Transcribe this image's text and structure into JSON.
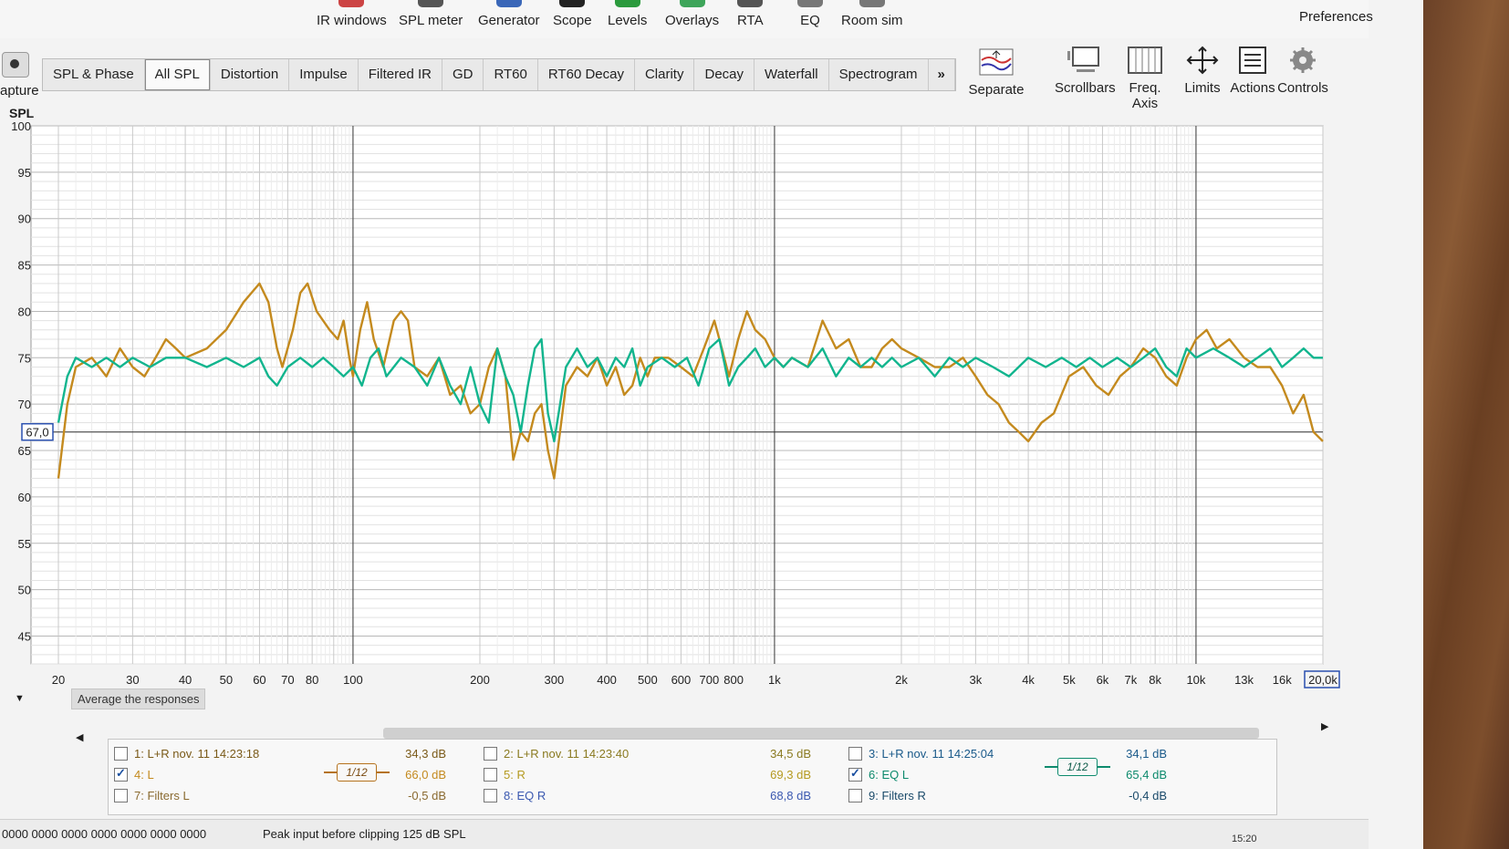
{
  "toolbar": {
    "buttons": [
      {
        "label": "IR windows",
        "x": 355,
        "color": "#c44"
      },
      {
        "label": "SPL meter",
        "x": 445,
        "color": "#555"
      },
      {
        "label": "Generator",
        "x": 532,
        "color": "#3a67b8"
      },
      {
        "label": "Scope",
        "x": 614,
        "color": "#222"
      },
      {
        "label": "Levels",
        "x": 674,
        "color": "#2b9a3d"
      },
      {
        "label": "Overlays",
        "x": 737,
        "color": "#3ea55a"
      },
      {
        "label": "RTA",
        "x": 816,
        "color": "#555"
      },
      {
        "label": "EQ",
        "x": 882,
        "color": "#777"
      },
      {
        "label": "Room sim",
        "x": 930,
        "color": "#777"
      }
    ],
    "preferences": "Preferences"
  },
  "capture_label": "apture",
  "tabs": [
    "SPL & Phase",
    "All SPL",
    "Distortion",
    "Impulse",
    "Filtered IR",
    "GD",
    "RT60",
    "RT60 Decay",
    "Clarity",
    "Decay",
    "Waterfall",
    "Spectrogram",
    "»"
  ],
  "active_tab": "All SPL",
  "right_tools": [
    "Separate",
    "Scrollbars",
    "Freq. Axis",
    "Limits",
    "Actions",
    "Controls"
  ],
  "graph": {
    "y_label": "SPL",
    "y_ticks": [
      "100",
      "95",
      "90",
      "85",
      "80",
      "75",
      "70",
      "65",
      "60",
      "55",
      "50",
      "45"
    ],
    "x_ticks": [
      "20",
      "30",
      "40",
      "50",
      "60",
      "70",
      "80",
      "100",
      "200",
      "300",
      "400",
      "500",
      "600",
      "700",
      "800",
      "1k",
      "2k",
      "3k",
      "4k",
      "5k",
      "6k",
      "7k",
      "8k",
      "10k",
      "13k",
      "16k",
      "20,0k"
    ],
    "cursor_value": "67,0",
    "average_button": "Average the responses"
  },
  "chart_data": {
    "type": "line",
    "xlabel": "",
    "ylabel": "SPL",
    "xscale": "log",
    "xlim": [
      20,
      20000
    ],
    "ylim": [
      42,
      100
    ],
    "reference_line_y": 67,
    "series": [
      {
        "name": "4: L",
        "color": "#c48a1e",
        "points": [
          [
            19,
            57
          ],
          [
            20,
            62
          ],
          [
            21,
            70
          ],
          [
            22,
            74
          ],
          [
            24,
            75
          ],
          [
            26,
            73
          ],
          [
            28,
            76
          ],
          [
            30,
            74
          ],
          [
            32,
            73
          ],
          [
            34,
            75
          ],
          [
            36,
            77
          ],
          [
            38,
            76
          ],
          [
            40,
            75
          ],
          [
            45,
            76
          ],
          [
            50,
            78
          ],
          [
            55,
            81
          ],
          [
            60,
            83
          ],
          [
            63,
            81
          ],
          [
            66,
            76
          ],
          [
            68,
            74
          ],
          [
            72,
            78
          ],
          [
            75,
            82
          ],
          [
            78,
            83
          ],
          [
            82,
            80
          ],
          [
            88,
            78
          ],
          [
            92,
            77
          ],
          [
            95,
            79
          ],
          [
            98,
            75
          ],
          [
            100,
            73
          ],
          [
            104,
            78
          ],
          [
            108,
            81
          ],
          [
            112,
            77
          ],
          [
            118,
            74
          ],
          [
            125,
            79
          ],
          [
            130,
            80
          ],
          [
            135,
            79
          ],
          [
            140,
            74
          ],
          [
            150,
            73
          ],
          [
            160,
            75
          ],
          [
            170,
            71
          ],
          [
            180,
            72
          ],
          [
            190,
            69
          ],
          [
            200,
            70
          ],
          [
            210,
            74
          ],
          [
            220,
            76
          ],
          [
            230,
            73
          ],
          [
            240,
            64
          ],
          [
            250,
            67
          ],
          [
            260,
            66
          ],
          [
            270,
            69
          ],
          [
            280,
            70
          ],
          [
            290,
            65
          ],
          [
            300,
            62
          ],
          [
            320,
            72
          ],
          [
            340,
            74
          ],
          [
            360,
            73
          ],
          [
            380,
            75
          ],
          [
            400,
            72
          ],
          [
            420,
            74
          ],
          [
            440,
            71
          ],
          [
            460,
            72
          ],
          [
            480,
            75
          ],
          [
            500,
            73
          ],
          [
            520,
            75
          ],
          [
            560,
            75
          ],
          [
            600,
            74
          ],
          [
            640,
            73
          ],
          [
            680,
            76
          ],
          [
            720,
            79
          ],
          [
            750,
            76
          ],
          [
            780,
            73
          ],
          [
            820,
            77
          ],
          [
            860,
            80
          ],
          [
            900,
            78
          ],
          [
            950,
            77
          ],
          [
            1000,
            75
          ],
          [
            1050,
            74
          ],
          [
            1100,
            75
          ],
          [
            1200,
            74
          ],
          [
            1300,
            79
          ],
          [
            1400,
            76
          ],
          [
            1500,
            77
          ],
          [
            1600,
            74
          ],
          [
            1700,
            74
          ],
          [
            1800,
            76
          ],
          [
            1900,
            77
          ],
          [
            2000,
            76
          ],
          [
            2200,
            75
          ],
          [
            2400,
            74
          ],
          [
            2600,
            74
          ],
          [
            2800,
            75
          ],
          [
            3000,
            73
          ],
          [
            3200,
            71
          ],
          [
            3400,
            70
          ],
          [
            3600,
            68
          ],
          [
            3800,
            67
          ],
          [
            4000,
            66
          ],
          [
            4300,
            68
          ],
          [
            4600,
            69
          ],
          [
            5000,
            73
          ],
          [
            5400,
            74
          ],
          [
            5800,
            72
          ],
          [
            6200,
            71
          ],
          [
            6600,
            73
          ],
          [
            7000,
            74
          ],
          [
            7500,
            76
          ],
          [
            8000,
            75
          ],
          [
            8500,
            73
          ],
          [
            9000,
            72
          ],
          [
            9500,
            75
          ],
          [
            10000,
            77
          ],
          [
            10600,
            78
          ],
          [
            11200,
            76
          ],
          [
            12000,
            77
          ],
          [
            13000,
            75
          ],
          [
            14000,
            74
          ],
          [
            15000,
            74
          ],
          [
            16000,
            72
          ],
          [
            17000,
            69
          ],
          [
            18000,
            71
          ],
          [
            19000,
            67
          ],
          [
            20000,
            66
          ]
        ]
      },
      {
        "name": "6: EQ L",
        "color": "#12b58e",
        "points": [
          [
            19,
            63
          ],
          [
            20,
            68
          ],
          [
            21,
            73
          ],
          [
            22,
            75
          ],
          [
            24,
            74
          ],
          [
            26,
            75
          ],
          [
            28,
            74
          ],
          [
            30,
            75
          ],
          [
            33,
            74
          ],
          [
            36,
            75
          ],
          [
            40,
            75
          ],
          [
            45,
            74
          ],
          [
            50,
            75
          ],
          [
            55,
            74
          ],
          [
            60,
            75
          ],
          [
            63,
            73
          ],
          [
            66,
            72
          ],
          [
            70,
            74
          ],
          [
            75,
            75
          ],
          [
            80,
            74
          ],
          [
            85,
            75
          ],
          [
            90,
            74
          ],
          [
            95,
            73
          ],
          [
            100,
            74
          ],
          [
            105,
            72
          ],
          [
            110,
            75
          ],
          [
            115,
            76
          ],
          [
            120,
            73
          ],
          [
            130,
            75
          ],
          [
            140,
            74
          ],
          [
            150,
            72
          ],
          [
            160,
            75
          ],
          [
            170,
            72
          ],
          [
            180,
            70
          ],
          [
            190,
            74
          ],
          [
            200,
            70
          ],
          [
            210,
            68
          ],
          [
            220,
            76
          ],
          [
            230,
            73
          ],
          [
            240,
            71
          ],
          [
            250,
            67
          ],
          [
            260,
            72
          ],
          [
            270,
            76
          ],
          [
            280,
            77
          ],
          [
            290,
            69
          ],
          [
            300,
            66
          ],
          [
            310,
            70
          ],
          [
            320,
            74
          ],
          [
            340,
            76
          ],
          [
            360,
            74
          ],
          [
            380,
            75
          ],
          [
            400,
            73
          ],
          [
            420,
            75
          ],
          [
            440,
            74
          ],
          [
            460,
            76
          ],
          [
            480,
            72
          ],
          [
            500,
            74
          ],
          [
            540,
            75
          ],
          [
            580,
            74
          ],
          [
            620,
            75
          ],
          [
            660,
            72
          ],
          [
            700,
            76
          ],
          [
            740,
            77
          ],
          [
            780,
            72
          ],
          [
            820,
            74
          ],
          [
            860,
            75
          ],
          [
            900,
            76
          ],
          [
            950,
            74
          ],
          [
            1000,
            75
          ],
          [
            1050,
            74
          ],
          [
            1100,
            75
          ],
          [
            1200,
            74
          ],
          [
            1300,
            76
          ],
          [
            1400,
            73
          ],
          [
            1500,
            75
          ],
          [
            1600,
            74
          ],
          [
            1700,
            75
          ],
          [
            1800,
            74
          ],
          [
            1900,
            75
          ],
          [
            2000,
            74
          ],
          [
            2200,
            75
          ],
          [
            2400,
            73
          ],
          [
            2600,
            75
          ],
          [
            2800,
            74
          ],
          [
            3000,
            75
          ],
          [
            3300,
            74
          ],
          [
            3600,
            73
          ],
          [
            4000,
            75
          ],
          [
            4400,
            74
          ],
          [
            4800,
            75
          ],
          [
            5200,
            74
          ],
          [
            5600,
            75
          ],
          [
            6000,
            74
          ],
          [
            6500,
            75
          ],
          [
            7000,
            74
          ],
          [
            7500,
            75
          ],
          [
            8000,
            76
          ],
          [
            8500,
            74
          ],
          [
            9000,
            73
          ],
          [
            9500,
            76
          ],
          [
            10000,
            75
          ],
          [
            11000,
            76
          ],
          [
            12000,
            75
          ],
          [
            13000,
            74
          ],
          [
            14000,
            75
          ],
          [
            15000,
            76
          ],
          [
            16000,
            74
          ],
          [
            17000,
            75
          ],
          [
            18000,
            76
          ],
          [
            19000,
            75
          ],
          [
            20000,
            75
          ]
        ]
      }
    ]
  },
  "measurements": {
    "rows": [
      {
        "label": "1: L+R nov. 11 14:23:18",
        "checked": false,
        "value": "34,3 dB",
        "col": 0,
        "row": 0,
        "color": "#7a5a18"
      },
      {
        "label": "4: L",
        "checked": true,
        "value": "66,0 dB",
        "col": 0,
        "row": 1,
        "color": "#c48a1e"
      },
      {
        "label": "7: Filters L",
        "checked": false,
        "value": "-0,5 dB",
        "col": 0,
        "row": 2,
        "color": "#8a6a30"
      },
      {
        "label": "2: L+R nov. 11 14:23:40",
        "checked": false,
        "value": "34,5 dB",
        "col": 1,
        "row": 0,
        "color": "#8a7a20"
      },
      {
        "label": "5: R",
        "checked": false,
        "value": "69,3 dB",
        "col": 1,
        "row": 1,
        "color": "#b59a20"
      },
      {
        "label": "8: EQ R",
        "checked": false,
        "value": "68,8 dB",
        "col": 1,
        "row": 2,
        "color": "#3a58b0"
      },
      {
        "label": "3: L+R nov. 11 14:25:04",
        "checked": false,
        "value": "34,1 dB",
        "col": 2,
        "row": 0,
        "color": "#1a5a8a"
      },
      {
        "label": "6: EQ L",
        "checked": true,
        "value": "65,4 dB",
        "col": 2,
        "row": 1,
        "color": "#0d8a6d"
      },
      {
        "label": "9: Filters R",
        "checked": false,
        "value": "-0,4 dB",
        "col": 2,
        "row": 2,
        "color": "#1a4a6a"
      }
    ],
    "smoothing_left": "1/12",
    "smoothing_right": "1/12"
  },
  "status": {
    "counters": "0000 0000 0000 0000 0000 0000 0000",
    "message": "Peak input before clipping 125 dB SPL",
    "clock": "15:20"
  }
}
